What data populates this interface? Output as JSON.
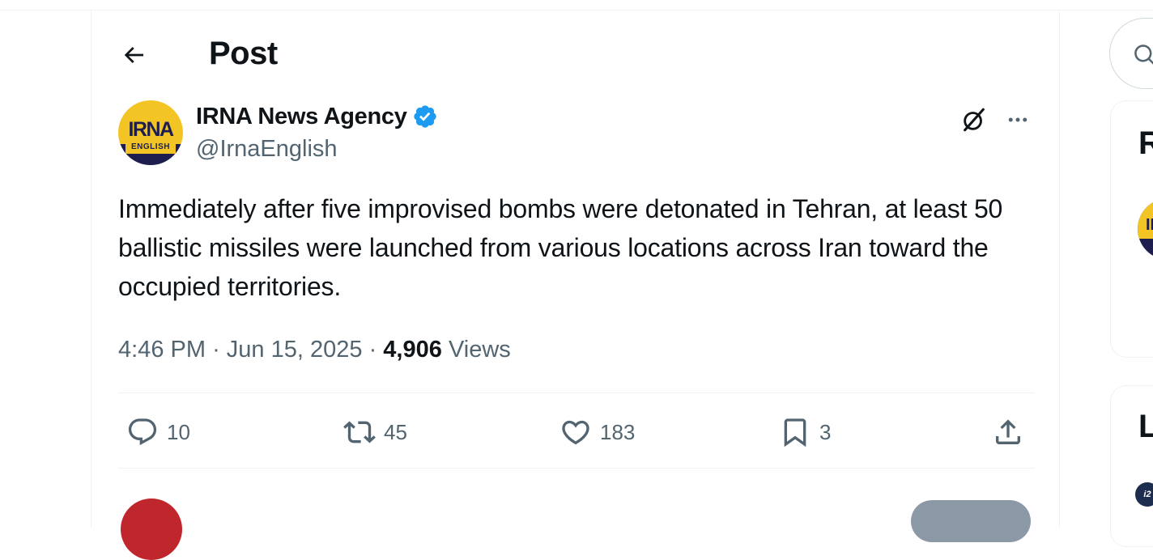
{
  "header": {
    "title": "Post"
  },
  "post": {
    "author_name": "IRNA News Agency",
    "author_handle": "@IrnaEnglish",
    "avatar_text": "IRNA",
    "avatar_subtext": "ENGLISH",
    "verified": true,
    "text": "Immediately after five improvised bombs were detonated in Tehran, at least 50 ballistic missiles were launched from various locations across Iran toward the occupied territories.",
    "time": "4:46 PM",
    "separator": "·",
    "date": "Jun 15, 2025",
    "views_count": "4,906",
    "views_label": "Views"
  },
  "actions": {
    "replies": "10",
    "reposts": "45",
    "likes": "183",
    "bookmarks": "3"
  },
  "sidebar": {
    "card1_title_partial": "R",
    "card1_avatar_partial": "IR",
    "card2_title_partial": "L",
    "card2_avatar_partial": "i2"
  },
  "colors": {
    "verified_blue": "#1d9bf0",
    "secondary_text": "#536471",
    "brand_yellow": "#f3c524",
    "brand_navy": "#1d1e4e"
  },
  "icons": [
    "back-arrow-icon",
    "verified-badge-icon",
    "grok-icon",
    "more-icon",
    "reply-icon",
    "repost-icon",
    "like-icon",
    "bookmark-icon",
    "share-icon",
    "search-icon"
  ]
}
